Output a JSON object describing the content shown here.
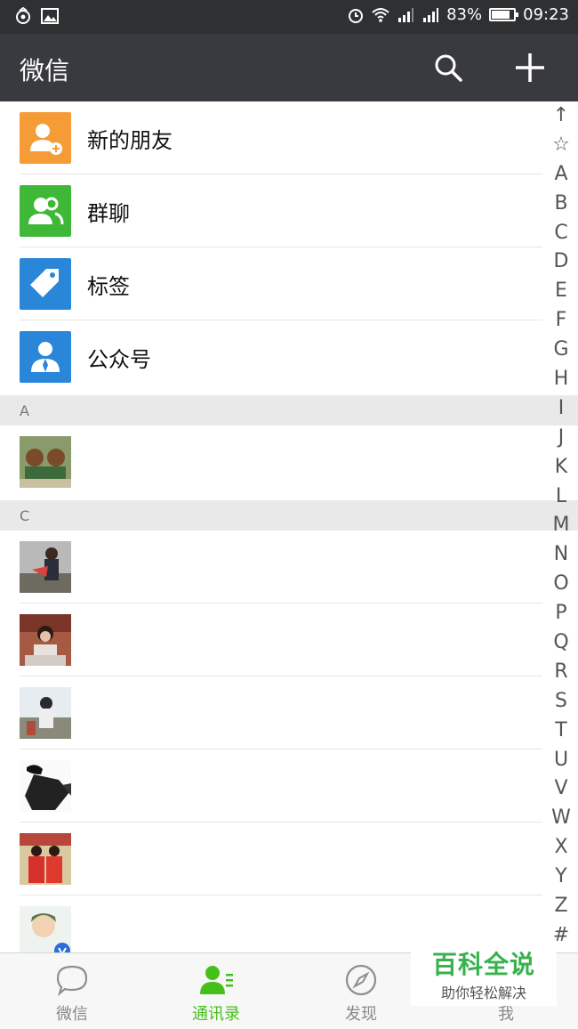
{
  "status_bar": {
    "battery": "83%",
    "time": "09:23",
    "battery_level": 0.83
  },
  "header": {
    "title": "微信"
  },
  "menu": [
    {
      "label": "新的朋友",
      "color": "#f69c36"
    },
    {
      "label": "群聊",
      "color": "#3fb838"
    },
    {
      "label": "标签",
      "color": "#2a86d9"
    },
    {
      "label": "公众号",
      "color": "#2a86d9"
    }
  ],
  "sections": [
    {
      "letter": "A"
    },
    {
      "letter": "C"
    }
  ],
  "index": [
    "↑",
    "☆",
    "A",
    "B",
    "C",
    "D",
    "E",
    "F",
    "G",
    "H",
    "I",
    "J",
    "K",
    "L",
    "M",
    "N",
    "O",
    "P",
    "Q",
    "R",
    "S",
    "T",
    "U",
    "V",
    "W",
    "X",
    "Y",
    "Z",
    "#"
  ],
  "tabs": [
    {
      "label": "微信",
      "icon": "chat-icon"
    },
    {
      "label": "通讯录",
      "icon": "contacts-icon"
    },
    {
      "label": "发现",
      "icon": "compass-icon"
    },
    {
      "label": "我",
      "icon": "person-icon"
    }
  ],
  "watermark": {
    "main": "百科全说",
    "sub": "助你轻松解决"
  },
  "colors": {
    "accent": "#45c01a",
    "titlebar": "#393a3f"
  }
}
